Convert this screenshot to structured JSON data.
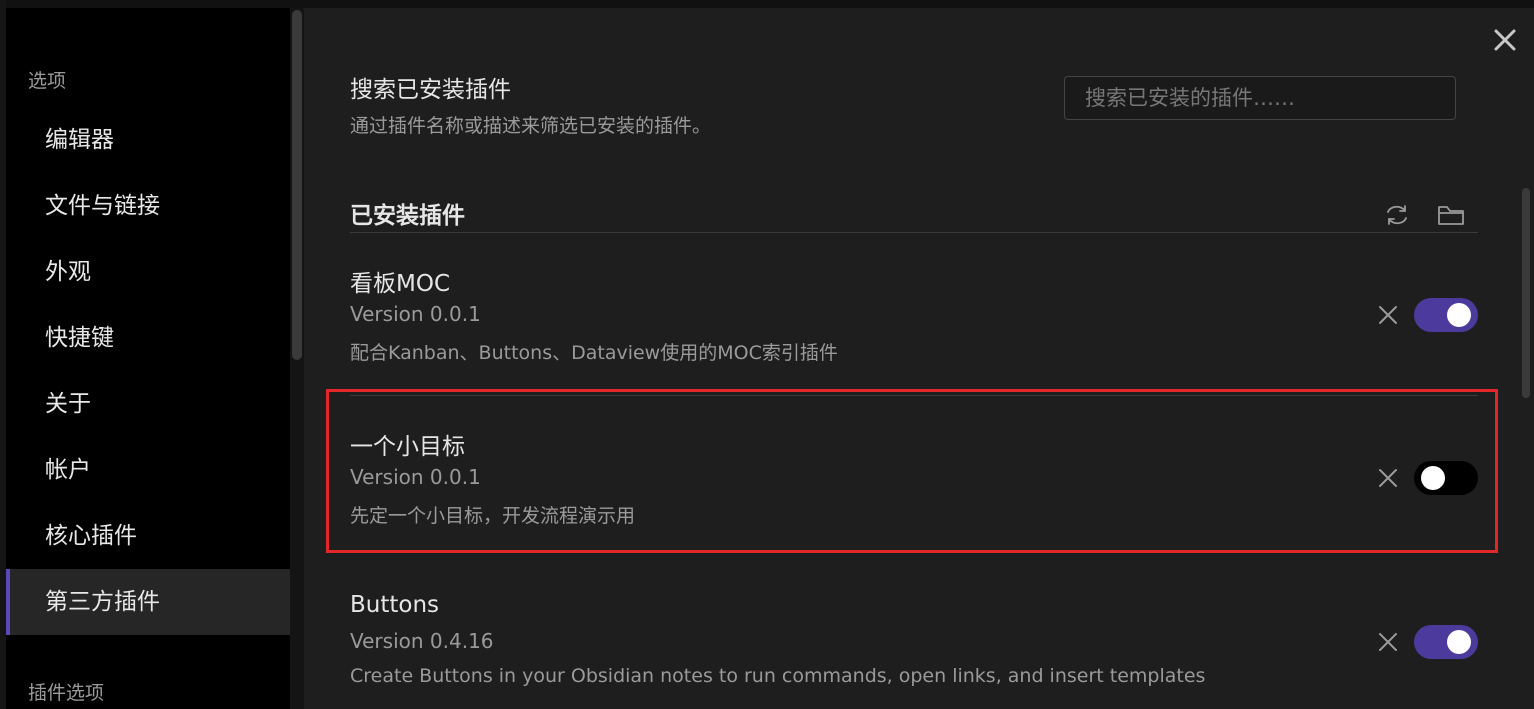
{
  "sidebar": {
    "options_heading": "选项",
    "items": [
      {
        "label": "编辑器"
      },
      {
        "label": "文件与链接"
      },
      {
        "label": "外观"
      },
      {
        "label": "快捷键"
      },
      {
        "label": "关于"
      },
      {
        "label": "帐户"
      },
      {
        "label": "核心插件"
      },
      {
        "label": "第三方插件"
      }
    ],
    "active_item": "第三方插件",
    "plugin_options_heading": "插件选项"
  },
  "search": {
    "title": "搜索已安装插件",
    "description": "通过插件名称或描述来筛选已安装的插件。",
    "placeholder": "搜索已安装的插件……"
  },
  "installed": {
    "title": "已安装插件",
    "reload_icon": "reload-icon",
    "folder_icon": "folder-icon"
  },
  "plugins": [
    {
      "name": "看板MOC",
      "version": "Version 0.0.1",
      "description": "配合Kanban、Buttons、Dataview使用的MOC索引插件",
      "enabled": true
    },
    {
      "name": "一个小目标",
      "version": "Version 0.0.1",
      "description": "先定一个小目标，开发流程演示用",
      "enabled": false
    },
    {
      "name": "Buttons",
      "version": "Version 0.4.16",
      "description": "Create Buttons in your Obsidian notes to run commands, open links, and insert templates",
      "enabled": true
    }
  ],
  "colors": {
    "accent": "#4c3a9c",
    "highlight_border": "#e3262a",
    "background": "#1e1e1e",
    "sidebar_background": "#000000"
  }
}
